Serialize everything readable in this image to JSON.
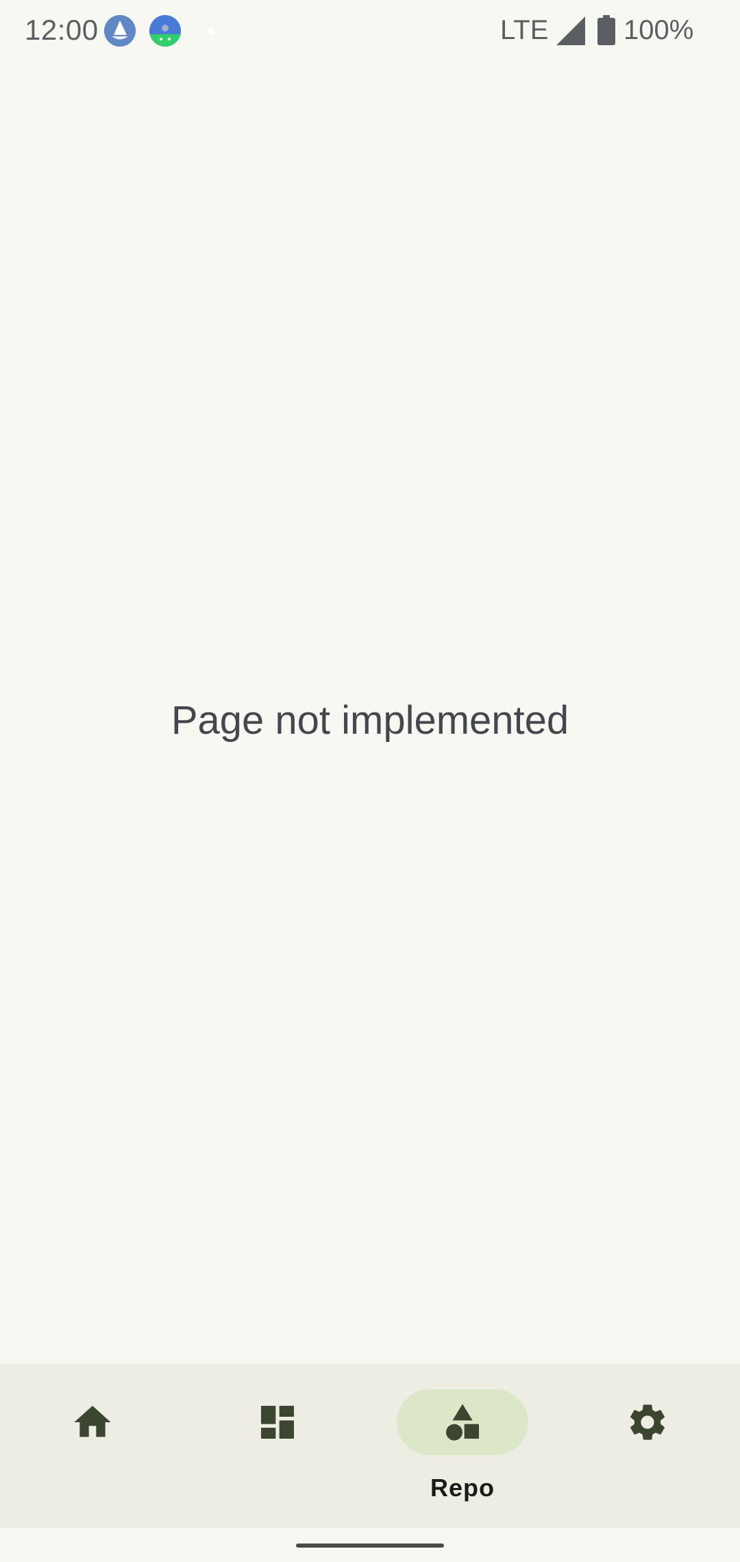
{
  "status_bar": {
    "time": "12:00",
    "network": "LTE",
    "battery": "100%",
    "notification_icons": [
      "sailboat-app-icon",
      "fdroid-app-icon"
    ],
    "icons": [
      "signal-icon",
      "battery-icon"
    ]
  },
  "main": {
    "message": "Page not implemented"
  },
  "bottom_nav": {
    "items": [
      {
        "icon": "home-icon",
        "label": "",
        "active": false
      },
      {
        "icon": "dashboard-icon",
        "label": "",
        "active": false
      },
      {
        "icon": "shapes-icon",
        "label": "Repo",
        "active": true
      },
      {
        "icon": "settings-gear-icon",
        "label": "",
        "active": false
      }
    ]
  },
  "colors": {
    "background": "#f7f8f1",
    "nav_background": "#edede3",
    "active_indicator": "#dce7c8",
    "icon_color": "#3b4530",
    "text_color": "#44474e"
  }
}
